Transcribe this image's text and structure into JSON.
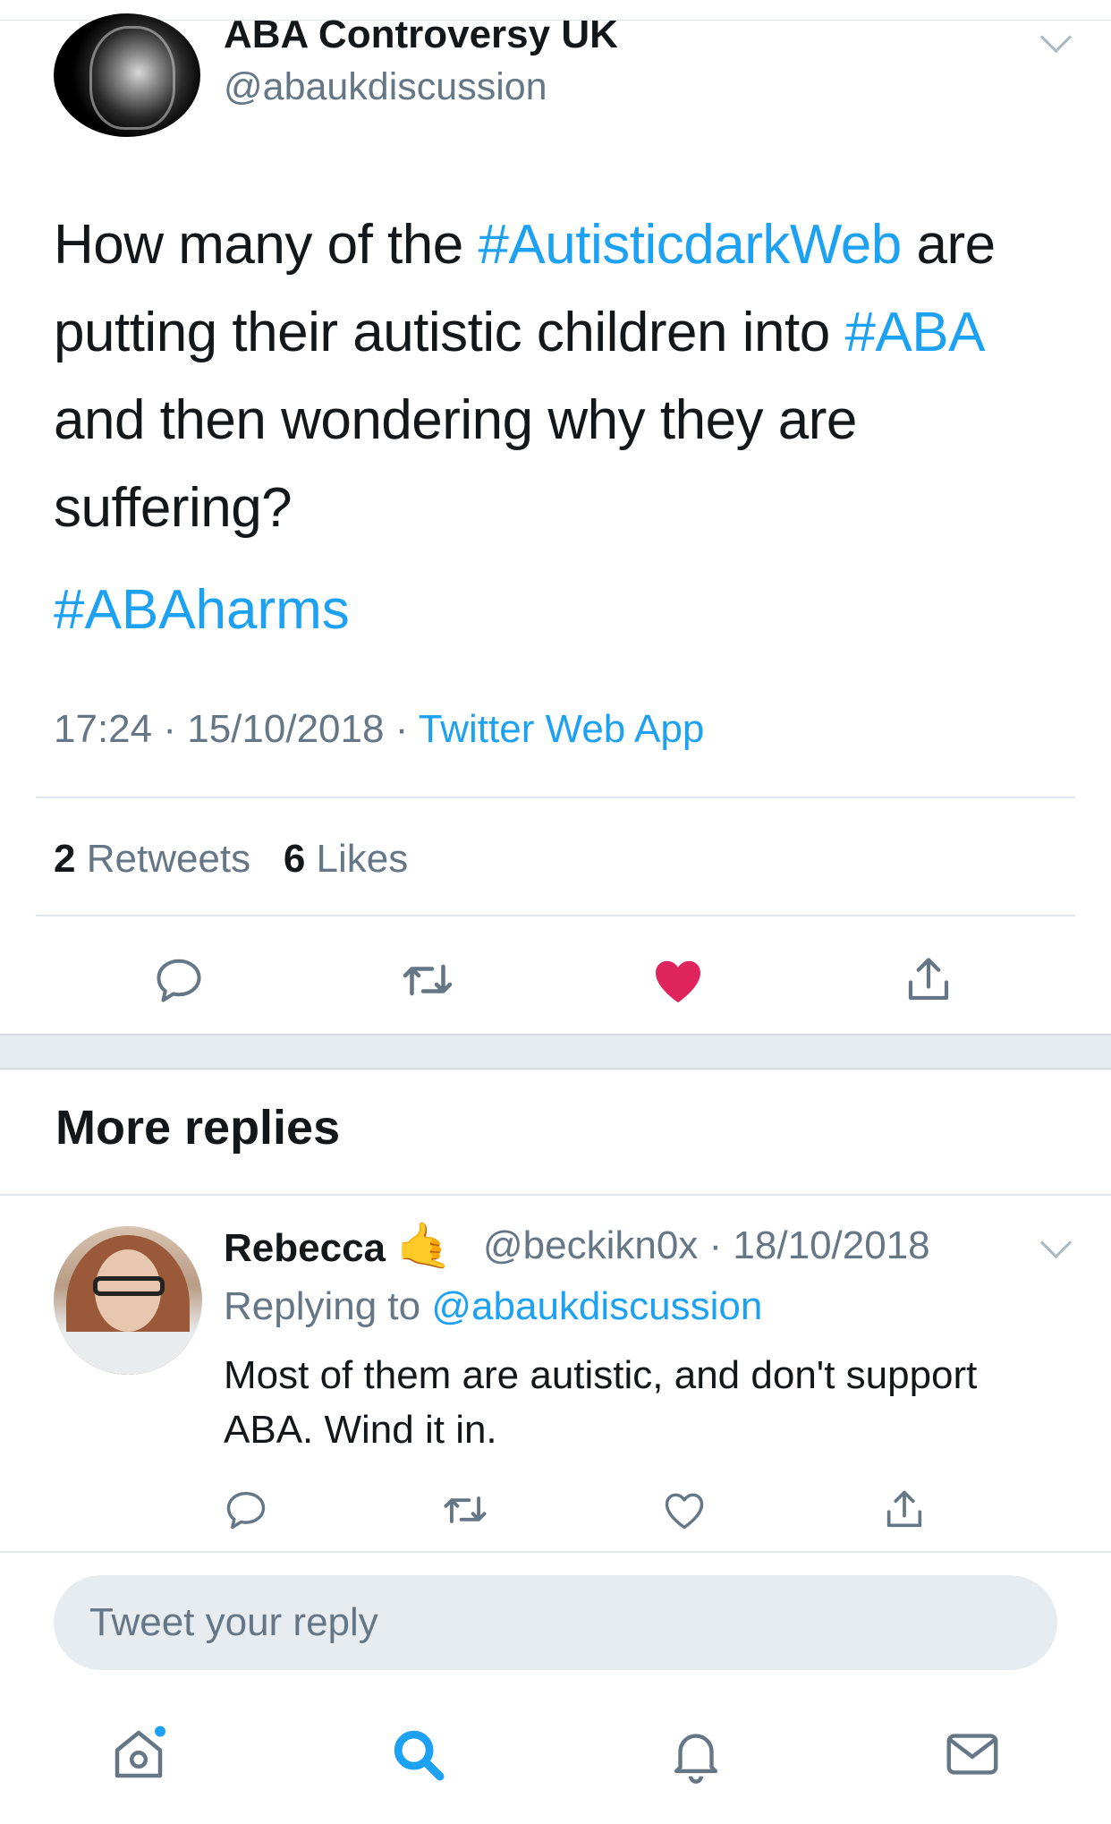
{
  "tweet": {
    "display_name": "ABA Controversy UK",
    "handle": "@abaukdiscussion",
    "text": {
      "line1_a": "How many of the ",
      "line1_tag": "#AutisticdarkWeb",
      "line1_b": " are",
      "line2_a": "putting their autistic children into ",
      "line2_tag": "#ABA",
      "line3": "and then wondering why they are",
      "line4": "suffering?",
      "hashtag": "#ABAharms"
    },
    "time": "17:24",
    "date": "15/10/2018",
    "separator": "·",
    "client": "Twitter Web App",
    "retweets_count": "2",
    "retweets_label": "Retweets",
    "likes_count": "6",
    "likes_label": "Likes",
    "liked": true
  },
  "section": {
    "more_replies": "More replies"
  },
  "reply": {
    "display_name": "Rebecca",
    "emoji": "🤙",
    "handle_date": "@beckikn0x · 18/10/2018",
    "replying_to_label": "Replying to",
    "replying_to_handle": "@abaukdiscussion",
    "text": "Most of them are autistic, and don't support ABA. Wind it in."
  },
  "composer": {
    "placeholder": "Tweet your reply"
  },
  "tab_bar": {
    "items": [
      "home-icon",
      "search-icon",
      "notifications-icon",
      "messages-icon"
    ],
    "active": "search-icon",
    "home_has_dot": true
  },
  "colors": {
    "accent": "#1da1f2",
    "like": "#e0245e",
    "grey": "#657786",
    "icon_grey": "#657786"
  }
}
